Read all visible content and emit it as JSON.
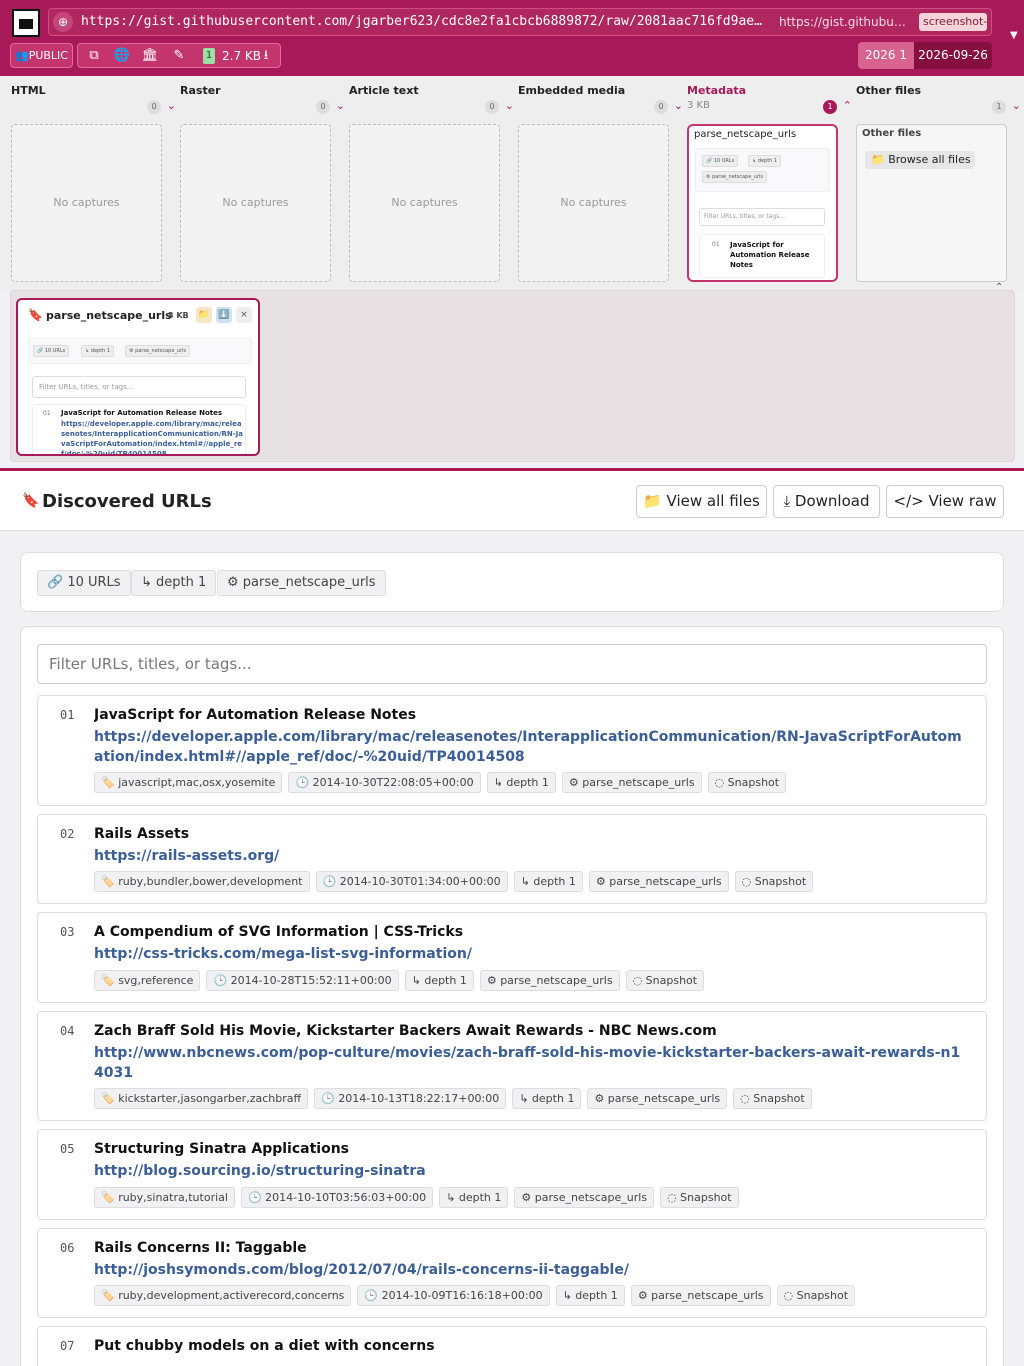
{
  "browser": {
    "url": "https://gist.githubusercontent.com/jgarber623/cdc8e2fa1cbcb6889872/raw/2081aac716fd9ae…",
    "url_short": "https://gist.githubuse…",
    "chip": "screenshot-g"
  },
  "toolbar": {
    "public_label": "👥PUBLIC",
    "copy_icon": "⧉",
    "globe_icon": "🌐",
    "archive_icon": "🏛",
    "edit_icon": "✎",
    "size_count": "1",
    "size_text": "2.7 KB",
    "download_icon": "⭳",
    "year_label": "2026 1",
    "date_label": "2026-09-26"
  },
  "columns": {
    "html": {
      "title": "HTML",
      "count": "0",
      "empty": "No captures"
    },
    "raster": {
      "title": "Raster",
      "count": "0",
      "empty": "No captures"
    },
    "article": {
      "title": "Article text",
      "count": "0",
      "empty": "No captures"
    },
    "embedded": {
      "title": "Embedded media",
      "count": "0",
      "empty": "No captures"
    },
    "metadata": {
      "title": "Metadata",
      "size": "3 KB",
      "count": "1",
      "card_title": "parse_netscape_urls",
      "chip_urls": "🔗 10 URLs",
      "chip_depth": "↳ depth 1",
      "chip_parser": "⚙ parse_netscape_urls",
      "filter": "Filter URLs, titles, or tags...",
      "item_num": "01",
      "item_title": "JavaScript for Automation Release Notes"
    },
    "other": {
      "title": "Other files",
      "count": "1",
      "card_title": "Other files",
      "browse": "📁 Browse all files"
    }
  },
  "preview": {
    "title": "parse_netscape_urls",
    "size": "3 KB",
    "btn_folder": "📁",
    "btn_download": "⬇️",
    "btn_close": "×",
    "chip_urls": "🔗 10 URLs",
    "chip_depth": "↳ depth 1",
    "chip_parser": "⚙ parse_netscape_urls",
    "filter": "Filter URLs, titles, or tags...",
    "item_num": "01",
    "item_title": "JavaScript for Automation Release Notes",
    "item_url": "https://developer.apple.com/library/mac/releasenotes/InterapplicationCommunication/RN-JavaScriptForAutomation/index.html#//apple_ref/doc/-%20uid/TP40014508"
  },
  "main": {
    "title": "Discovered URLs",
    "btn_view_files": "📁 View all files",
    "btn_download": "⤓ Download",
    "btn_view_raw": "</> View raw",
    "summary": {
      "urls": "🔗 10 URLs",
      "depth": "↳ depth 1",
      "parser": "⚙ parse_netscape_urls"
    },
    "filter_placeholder": "Filter URLs, titles, or tags...",
    "items": [
      {
        "num": "01",
        "title": "JavaScript for Automation Release Notes",
        "url": "https://developer.apple.com/library/mac/releasenotes/InterapplicationCommunication/RN-JavaScriptForAutomation/index.html#//apple_ref/doc/-%20uid/TP40014508",
        "tags": "🏷️ javascript,mac,osx,yosemite",
        "time": "🕒 2014-10-30T22:08:05+00:00",
        "depth": "↳ depth 1",
        "parser": "⚙ parse_netscape_urls",
        "snapshot": "◌ Snapshot"
      },
      {
        "num": "02",
        "title": "Rails Assets",
        "url": "https://rails-assets.org/",
        "tags": "🏷️ ruby,bundler,bower,development",
        "time": "🕒 2014-10-30T01:34:00+00:00",
        "depth": "↳ depth 1",
        "parser": "⚙ parse_netscape_urls",
        "snapshot": "◌ Snapshot"
      },
      {
        "num": "03",
        "title": "A Compendium of SVG Information | CSS-Tricks",
        "url": "http://css-tricks.com/mega-list-svg-information/",
        "tags": "🏷️ svg,reference",
        "time": "🕒 2014-10-28T15:52:11+00:00",
        "depth": "↳ depth 1",
        "parser": "⚙ parse_netscape_urls",
        "snapshot": "◌ Snapshot"
      },
      {
        "num": "04",
        "title": "Zach Braff Sold His Movie, Kickstarter Backers Await Rewards - NBC News.com",
        "url": "http://www.nbcnews.com/pop-culture/movies/zach-braff-sold-his-movie-kickstarter-backers-await-rewards-n14031",
        "tags": "🏷️ kickstarter,jasongarber,zachbraff",
        "time": "🕒 2014-10-13T18:22:17+00:00",
        "depth": "↳ depth 1",
        "parser": "⚙ parse_netscape_urls",
        "snapshot": "◌ Snapshot"
      },
      {
        "num": "05",
        "title": "Structuring Sinatra Applications",
        "url": "http://blog.sourcing.io/structuring-sinatra",
        "tags": "🏷️ ruby,sinatra,tutorial",
        "time": "🕒 2014-10-10T03:56:03+00:00",
        "depth": "↳ depth 1",
        "parser": "⚙ parse_netscape_urls",
        "snapshot": "◌ Snapshot"
      },
      {
        "num": "06",
        "title": "Rails Concerns II: Taggable",
        "url": "http://joshsymonds.com/blog/2012/07/04/rails-concerns-ii-taggable/",
        "tags": "🏷️ ruby,development,activerecord,concerns",
        "time": "🕒 2014-10-09T16:16:18+00:00",
        "depth": "↳ depth 1",
        "parser": "⚙ parse_netscape_urls",
        "snapshot": "◌ Snapshot"
      },
      {
        "num": "07",
        "title": "Put chubby models on a diet with concerns",
        "url": "",
        "tags": "",
        "time": "",
        "depth": "",
        "parser": "",
        "snapshot": ""
      }
    ]
  }
}
